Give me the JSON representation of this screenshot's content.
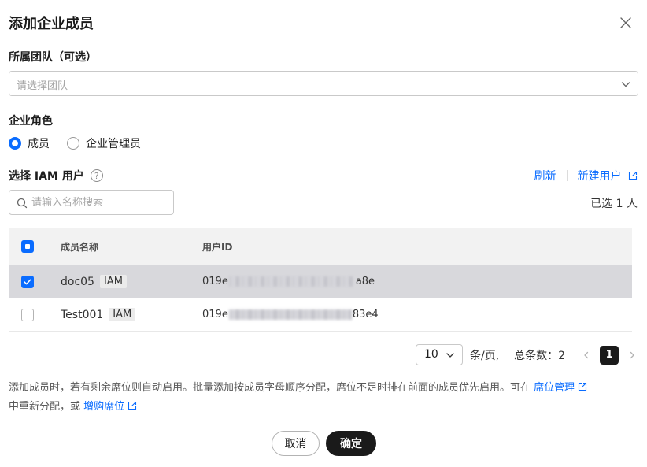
{
  "dialog": {
    "title": "添加企业成员",
    "close_icon": "close-icon"
  },
  "team": {
    "label": "所属团队（可选）",
    "placeholder": "请选择团队"
  },
  "role": {
    "label": "企业角色",
    "options": [
      {
        "label": "成员",
        "checked": true
      },
      {
        "label": "企业管理员",
        "checked": false
      }
    ]
  },
  "iam": {
    "label": "选择 IAM 用户",
    "help_icon": "question-circle-icon",
    "refresh_label": "刷新",
    "create_label": "新建用户",
    "search_placeholder": "请输入名称搜索",
    "selected_text": "已选 1 人"
  },
  "table": {
    "columns": [
      "成员名称",
      "用户ID"
    ],
    "rows": [
      {
        "name": "doc05",
        "tag": "IAM",
        "id_prefix": "019e",
        "id_suffix": "a8e",
        "checked": true
      },
      {
        "name": "Test001",
        "tag": "IAM",
        "id_prefix": "019e",
        "id_suffix": "83e4",
        "checked": false
      }
    ]
  },
  "pagination": {
    "page_size": "10",
    "per_page_text": "条/页,",
    "total_text": "总条数：2",
    "current_page": "1"
  },
  "note": {
    "text1": "添加成员时，若有剩余席位则自动启用。批量添加按成员字母顺序分配，席位不足时排在前面的成员优先启用。可在 ",
    "link1": "席位管理",
    "text2": "中重新分配，或 ",
    "link2": "增购席位"
  },
  "footer": {
    "cancel_label": "取消",
    "ok_label": "确定"
  },
  "colors": {
    "accent": "#0a6cff",
    "primary_button": "#1a1a1a",
    "selected_row": "#d8d8dc"
  }
}
